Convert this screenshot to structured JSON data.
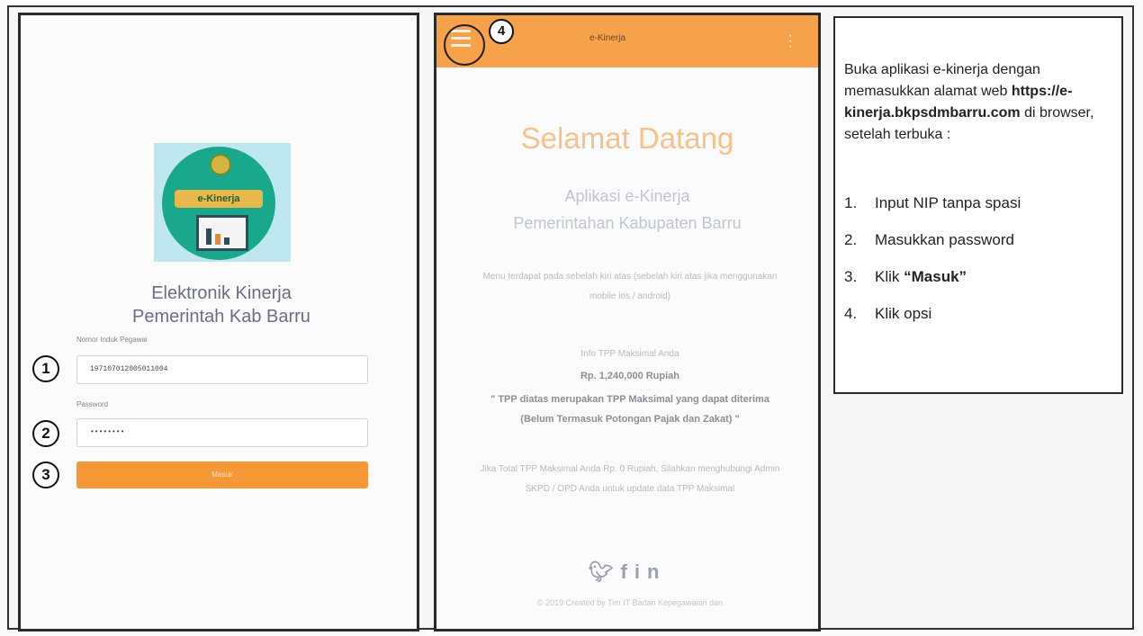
{
  "login": {
    "logo_text": "e-Kinerja",
    "app_title_line1": "Elektronik Kinerja",
    "app_title_line2": "Pemerintah Kab Barru",
    "nip_label": "Nomor Induk Pegawai",
    "nip_value": "197107012005011004",
    "password_label": "Password",
    "password_value": "••••••••",
    "submit_label": "Masuk",
    "callouts": [
      "1",
      "2",
      "3"
    ]
  },
  "home": {
    "brand": "e-Kinerja",
    "menu_callout": "4",
    "welcome": "Selamat Datang",
    "subtitle_line1": "Aplikasi e-Kinerja",
    "subtitle_line2": "Pemerintahan Kabupaten Barru",
    "menu_hint": "Menu terdapat pada sebelah kiri atas (sebelah kiri atas jika menggunakan mobile ios / android)",
    "tpp_label": "Info TPP Maksimal Anda",
    "tpp_value": "Rp. 1,240,000 Rupiah",
    "tpp_note": "\" TPP diatas merupakan TPP Maksimal yang dapat diterima (Belum Termasuk Potongan Pajak dan Zakat) \"",
    "tpp_zero_note": "Jika Total TPP Maksimal Anda Rp. 0 Rupiah, Silahkan menghubungi Admin SKPD / OPD Anda untuk update data TPP Maksimal",
    "social_icons": [
      "twitter-icon",
      "facebook-icon",
      "linkedin-icon"
    ],
    "footer": "© 2019 Created by Tim IT Badan Kepegawaian dan"
  },
  "instructions": {
    "intro_1": "Buka aplikasi e-kinerja dengan memasukkan alamat web ",
    "url": "https://e-kinerja.bkpsdmbarru.com",
    "intro_2": " di browser, setelah terbuka :",
    "steps": [
      {
        "n": "1.",
        "text": "Input NIP tanpa spasi"
      },
      {
        "n": "2.",
        "text": "Masukkan password"
      },
      {
        "n": "3.",
        "pre": "Klik ",
        "bold": "“Masuk”"
      },
      {
        "n": "4.",
        "text": "Klik opsi"
      }
    ]
  }
}
